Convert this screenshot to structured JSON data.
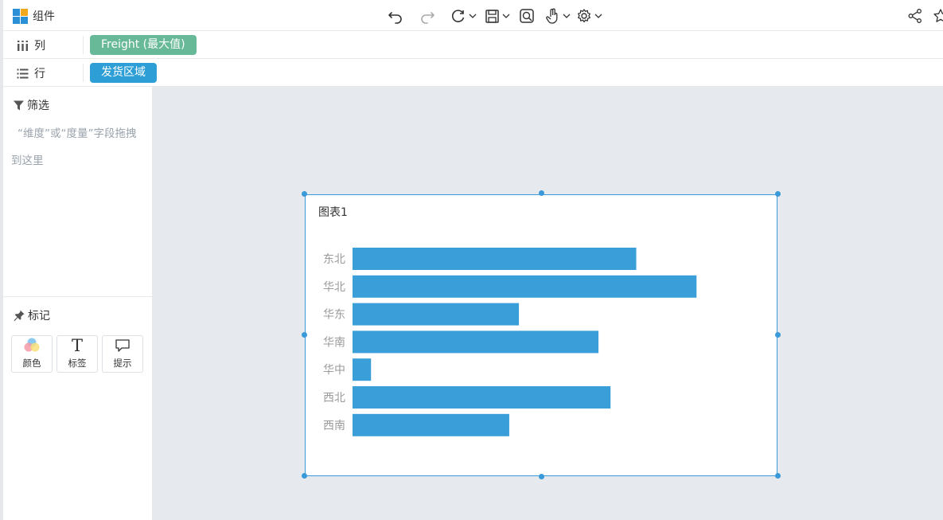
{
  "app": {
    "component_label": "组件"
  },
  "toolbar": {
    "icons": [
      "undo-icon",
      "redo-icon",
      "refresh-icon",
      "save-icon",
      "preview-icon",
      "pan-hand-icon",
      "settings-icon",
      "share-icon",
      "star-icon"
    ]
  },
  "shelves": {
    "columns": {
      "label": "列",
      "pill": "Freight (最大值)",
      "pill_color": "#67b997"
    },
    "rows": {
      "label": "行",
      "pill": "发货区域",
      "pill_color": "#2e9fd6"
    }
  },
  "filter": {
    "title": "筛选",
    "hint": "“维度”或“度量”字段拖拽到这里"
  },
  "marks": {
    "title": "标记",
    "buttons": [
      {
        "label": "颜色",
        "icon": "color-palette-icon"
      },
      {
        "label": "标签",
        "icon": "text-label-icon"
      },
      {
        "label": "提示",
        "icon": "tooltip-icon"
      }
    ]
  },
  "colors": {
    "accent": "#3a9ad9",
    "bar": "#3a9fd9",
    "canvas_bg": "#e6e9ed"
  },
  "chart_data": {
    "type": "bar",
    "orientation": "horizontal",
    "title": "图表1",
    "categories": [
      "东北",
      "华北",
      "华东",
      "华南",
      "华中",
      "西北",
      "西南"
    ],
    "values": [
      353,
      428,
      207,
      306,
      23,
      321,
      195
    ],
    "xlim": [
      0,
      500
    ],
    "axis_labels_visible": false,
    "grid": false
  }
}
